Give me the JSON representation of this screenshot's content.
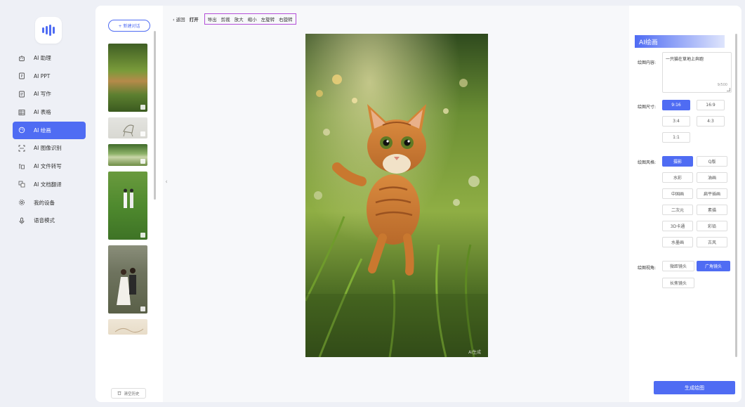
{
  "sidebar": {
    "items": [
      {
        "label": "AI 助理",
        "icon": "robot-icon"
      },
      {
        "label": "AI PPT",
        "icon": "ppt-icon"
      },
      {
        "label": "AI 写作",
        "icon": "document-icon"
      },
      {
        "label": "AI 表格",
        "icon": "table-icon"
      },
      {
        "label": "AI 绘画",
        "icon": "palette-icon",
        "active": true
      },
      {
        "label": "AI 图像识别",
        "icon": "scan-icon"
      },
      {
        "label": "AI 文件转写",
        "icon": "transcribe-icon"
      },
      {
        "label": "AI 文档翻译",
        "icon": "translate-icon"
      },
      {
        "label": "我的设备",
        "icon": "gear-icon"
      },
      {
        "label": "语音模式",
        "icon": "microphone-icon"
      }
    ]
  },
  "history": {
    "new_chat_label": "+ 新建对话",
    "clear_label": "清空历史"
  },
  "toolbar": {
    "back": "返回",
    "open": "打开",
    "export": "导出",
    "crop": "剪裁",
    "zoom_in": "放大",
    "zoom_out": "缩小",
    "rotate_left": "左旋转",
    "rotate_right": "右旋转"
  },
  "canvas": {
    "watermark": "AI生成"
  },
  "panel": {
    "title": "AI绘画",
    "content_label": "绘图内容:",
    "content_value": "一只猫在草地上奔跑",
    "char_count": "9/500",
    "size_label": "绘图尺寸:",
    "sizes": [
      "9:16",
      "16:9",
      "3:4",
      "4:3",
      "1:1"
    ],
    "size_selected": "9:16",
    "style_label": "绘图风格:",
    "styles": [
      "摄影",
      "Q版",
      "水彩",
      "油画",
      "中国画",
      "扁平插画",
      "二次元",
      "素描",
      "3D卡通",
      "彩铅",
      "水墨画",
      "古风"
    ],
    "style_selected": "摄影",
    "view_label": "绘图视角:",
    "views": [
      "微距镜头",
      "广角镜头",
      "长焦镜头"
    ],
    "view_selected": "广角镜头",
    "generate_label": "生成绘图"
  },
  "colors": {
    "accent": "#4f6cf3",
    "highlight_box": "#b44fd8"
  }
}
